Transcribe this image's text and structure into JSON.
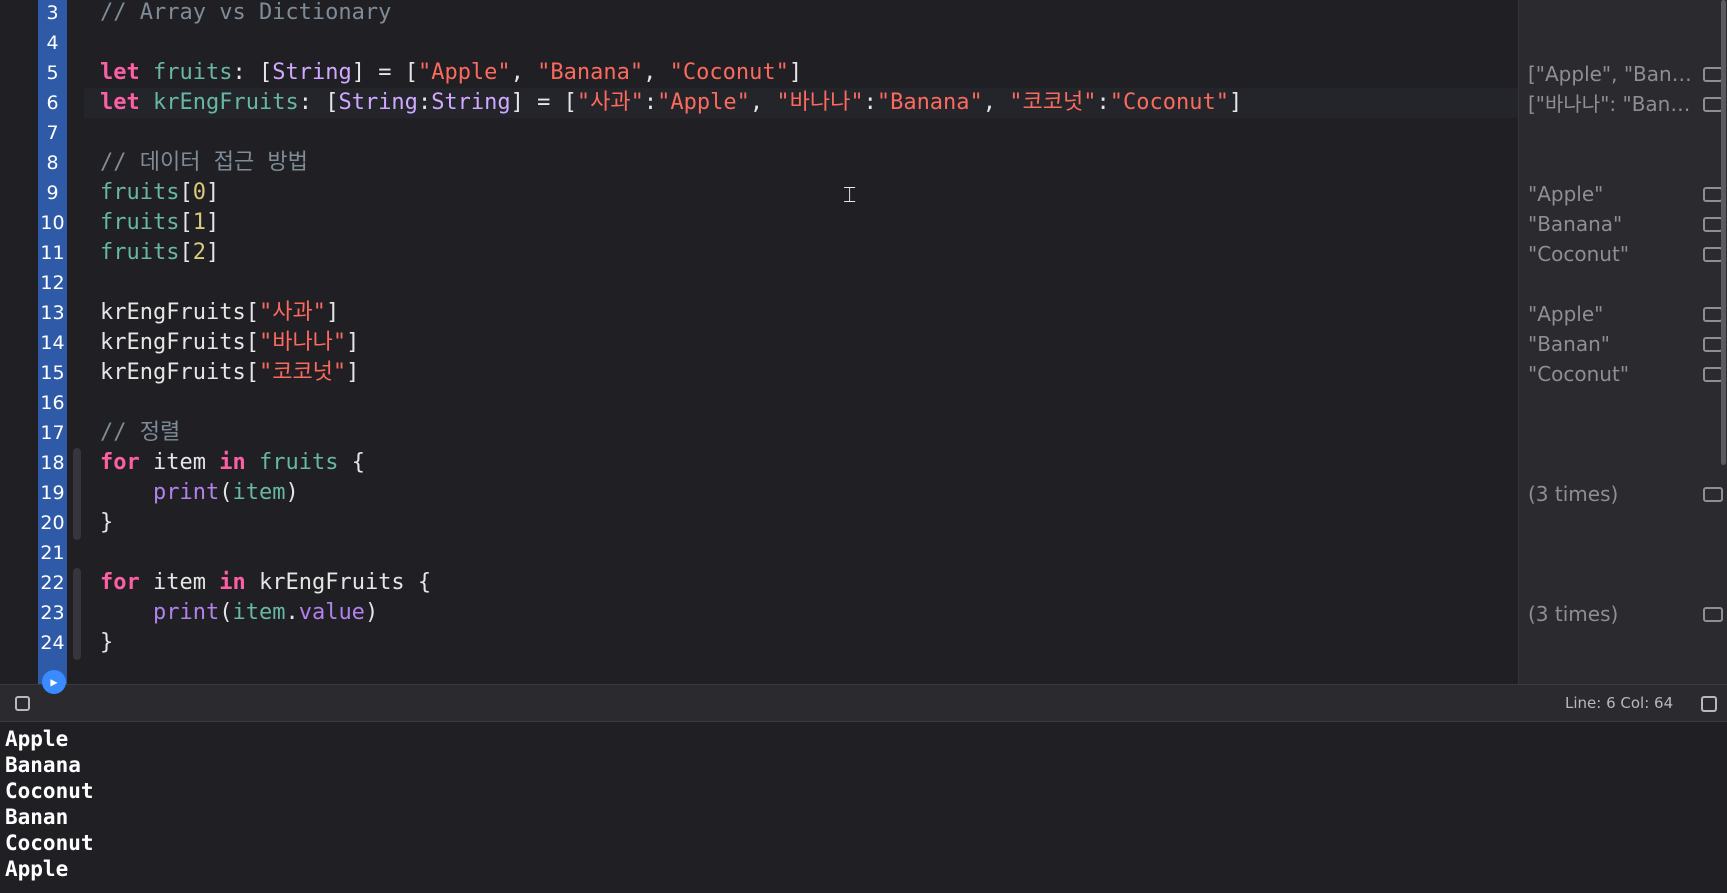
{
  "editor": {
    "lines": [
      {
        "n": "3",
        "tokens": [
          {
            "c": "cm",
            "t": "// Array vs Dictionary"
          }
        ]
      },
      {
        "n": "4",
        "tokens": []
      },
      {
        "n": "5",
        "tokens": [
          {
            "c": "kw",
            "t": "let"
          },
          {
            "c": "plain",
            "t": " "
          },
          {
            "c": "var",
            "t": "fruits"
          },
          {
            "c": "plain",
            "t": ": ["
          },
          {
            "c": "ty",
            "t": "String"
          },
          {
            "c": "plain",
            "t": "] = ["
          },
          {
            "c": "str",
            "t": "\"Apple\""
          },
          {
            "c": "plain",
            "t": ", "
          },
          {
            "c": "str",
            "t": "\"Banana\""
          },
          {
            "c": "plain",
            "t": ", "
          },
          {
            "c": "str",
            "t": "\"Coconut\""
          },
          {
            "c": "plain",
            "t": "]"
          }
        ]
      },
      {
        "n": "6",
        "tokens": [
          {
            "c": "kw",
            "t": "let"
          },
          {
            "c": "plain",
            "t": " "
          },
          {
            "c": "var",
            "t": "krEngFruits"
          },
          {
            "c": "plain",
            "t": ": ["
          },
          {
            "c": "ty",
            "t": "String"
          },
          {
            "c": "plain",
            "t": ":"
          },
          {
            "c": "ty",
            "t": "String"
          },
          {
            "c": "plain",
            "t": "] = ["
          },
          {
            "c": "str",
            "t": "\"사과\""
          },
          {
            "c": "plain",
            "t": ":"
          },
          {
            "c": "str",
            "t": "\"Apple\""
          },
          {
            "c": "plain",
            "t": ", "
          },
          {
            "c": "str",
            "t": "\"바나나\""
          },
          {
            "c": "plain",
            "t": ":"
          },
          {
            "c": "str",
            "t": "\"Banana\""
          },
          {
            "c": "plain",
            "t": ", "
          },
          {
            "c": "str",
            "t": "\"코코넛\""
          },
          {
            "c": "plain",
            "t": ":"
          },
          {
            "c": "str",
            "t": "\"Coconut\""
          },
          {
            "c": "plain",
            "t": "]"
          }
        ]
      },
      {
        "n": "7",
        "tokens": []
      },
      {
        "n": "8",
        "tokens": [
          {
            "c": "cm",
            "t": "// 데이터 접근 방법"
          }
        ]
      },
      {
        "n": "9",
        "tokens": [
          {
            "c": "var",
            "t": "fruits"
          },
          {
            "c": "plain",
            "t": "["
          },
          {
            "c": "num",
            "t": "0"
          },
          {
            "c": "plain",
            "t": "]"
          }
        ]
      },
      {
        "n": "10",
        "tokens": [
          {
            "c": "var",
            "t": "fruits"
          },
          {
            "c": "plain",
            "t": "["
          },
          {
            "c": "num",
            "t": "1"
          },
          {
            "c": "plain",
            "t": "]"
          }
        ]
      },
      {
        "n": "11",
        "tokens": [
          {
            "c": "var",
            "t": "fruits"
          },
          {
            "c": "plain",
            "t": "["
          },
          {
            "c": "num",
            "t": "2"
          },
          {
            "c": "plain",
            "t": "]"
          }
        ]
      },
      {
        "n": "12",
        "tokens": []
      },
      {
        "n": "13",
        "tokens": [
          {
            "c": "plain",
            "t": "krEngFruits["
          },
          {
            "c": "str",
            "t": "\"사과\""
          },
          {
            "c": "plain",
            "t": "]"
          }
        ]
      },
      {
        "n": "14",
        "tokens": [
          {
            "c": "plain",
            "t": "krEngFruits["
          },
          {
            "c": "str",
            "t": "\"바나나\""
          },
          {
            "c": "plain",
            "t": "]"
          }
        ]
      },
      {
        "n": "15",
        "tokens": [
          {
            "c": "plain",
            "t": "krEngFruits["
          },
          {
            "c": "str",
            "t": "\"코코넛\""
          },
          {
            "c": "plain",
            "t": "]"
          }
        ]
      },
      {
        "n": "16",
        "tokens": []
      },
      {
        "n": "17",
        "tokens": [
          {
            "c": "cm",
            "t": "// 정렬"
          }
        ]
      },
      {
        "n": "18",
        "tokens": [
          {
            "c": "kw",
            "t": "for"
          },
          {
            "c": "plain",
            "t": " item "
          },
          {
            "c": "kw",
            "t": "in"
          },
          {
            "c": "plain",
            "t": " "
          },
          {
            "c": "var",
            "t": "fruits"
          },
          {
            "c": "plain",
            "t": " {"
          }
        ]
      },
      {
        "n": "19",
        "tokens": [
          {
            "c": "plain",
            "t": "    "
          },
          {
            "c": "fn",
            "t": "print"
          },
          {
            "c": "plain",
            "t": "("
          },
          {
            "c": "var",
            "t": "item"
          },
          {
            "c": "plain",
            "t": ")"
          }
        ]
      },
      {
        "n": "20",
        "tokens": [
          {
            "c": "plain",
            "t": "}"
          }
        ]
      },
      {
        "n": "21",
        "tokens": []
      },
      {
        "n": "22",
        "tokens": [
          {
            "c": "kw",
            "t": "for"
          },
          {
            "c": "plain",
            "t": " item "
          },
          {
            "c": "kw",
            "t": "in"
          },
          {
            "c": "plain",
            "t": " krEngFruits {"
          }
        ]
      },
      {
        "n": "23",
        "tokens": [
          {
            "c": "plain",
            "t": "    "
          },
          {
            "c": "fn",
            "t": "print"
          },
          {
            "c": "plain",
            "t": "("
          },
          {
            "c": "var",
            "t": "item"
          },
          {
            "c": "plain",
            "t": "."
          },
          {
            "c": "fn",
            "t": "value"
          },
          {
            "c": "plain",
            "t": ")"
          }
        ]
      },
      {
        "n": "24",
        "tokens": [
          {
            "c": "plain",
            "t": "}"
          }
        ]
      }
    ]
  },
  "results": [
    {
      "line": "5",
      "text": "[\"Apple\", \"Bana..."
    },
    {
      "line": "6",
      "text": "[\"바나나\": \"Bana..."
    },
    {
      "line": "9",
      "text": "\"Apple\""
    },
    {
      "line": "10",
      "text": "\"Banana\""
    },
    {
      "line": "11",
      "text": "\"Coconut\""
    },
    {
      "line": "13",
      "text": "\"Apple\""
    },
    {
      "line": "14",
      "text": "\"Banan\""
    },
    {
      "line": "15",
      "text": "\"Coconut\""
    },
    {
      "line": "19",
      "text": "(3 times)"
    },
    {
      "line": "23",
      "text": "(3 times)"
    }
  ],
  "status": {
    "position": "Line: 6  Col: 64"
  },
  "console": {
    "output": [
      "Apple",
      "Banana",
      "Coconut",
      "Banan",
      "Coconut",
      "Apple"
    ]
  },
  "colors": {
    "line_band": "#2e5aa8",
    "keyword": "#fc5fa3",
    "string": "#fc6a5d",
    "type": "#d0a8ff"
  }
}
